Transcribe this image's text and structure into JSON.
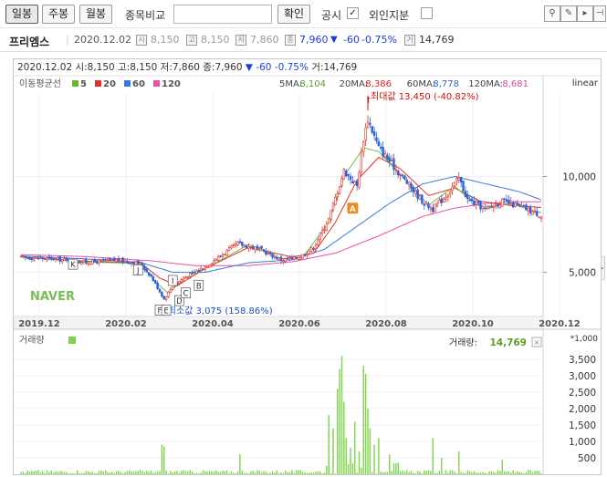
{
  "toolbar": {
    "tabs": [
      "일봉",
      "주봉",
      "월봉"
    ],
    "compare_label": "종목비교",
    "compare_value": "",
    "confirm_label": "확인",
    "disclosure_label": "공시",
    "disclosure_checked": "✓",
    "foreign_label": "외인지분",
    "foreign_checked": "",
    "right_icons": [
      "tool-icon",
      "pencil-icon",
      "cursor-icon",
      "pin-icon"
    ]
  },
  "infobar": {
    "name": "프리엠스",
    "date": "2020.12.02",
    "open_badge": "시",
    "open": "8,150",
    "high_badge": "고",
    "high": "8,150",
    "low_badge": "저",
    "low": "7,860",
    "close_badge": "종",
    "close": "7,960",
    "change_arrow": "▼",
    "change": "-60",
    "change_pct": "-0.75%",
    "volume_badge": "거",
    "volume": "14,769"
  },
  "chart_header": {
    "line": [
      {
        "text": "2020.12.02 시:",
        "color": "#333333"
      },
      {
        "text": "8,150",
        "color": "#333333"
      },
      {
        "text": " 고:",
        "color": "#333333"
      },
      {
        "text": "8,150",
        "color": "#333333"
      },
      {
        "text": " 저:",
        "color": "#333333"
      },
      {
        "text": "7,860",
        "color": "#333333"
      },
      {
        "text": " 종:",
        "color": "#333333"
      },
      {
        "text": "7,960",
        "color": "#333333"
      },
      {
        "text": " ▼",
        "color": "#1c3fd8"
      },
      {
        "text": "    -60",
        "color": "#1c3fd8"
      },
      {
        "text": "   -0.75%",
        "color": "#1c3fd8"
      },
      {
        "text": " 거:",
        "color": "#333333"
      },
      {
        "text": "14,769",
        "color": "#333333"
      }
    ],
    "scale_mode": "linear"
  },
  "ma_legend": {
    "title": "이동평균선",
    "items": [
      {
        "period": "5",
        "color": "#5fb833"
      },
      {
        "period": "20",
        "color": "#e0322a"
      },
      {
        "period": "60",
        "color": "#3a7bd5"
      },
      {
        "period": "120",
        "color": "#e94fa9"
      }
    ]
  },
  "ma_values": [
    {
      "label": "5MA:",
      "value": "8,104",
      "color": "#5a9c2a"
    },
    {
      "label": "20MA:",
      "value": "8,386",
      "color": "#d4281f"
    },
    {
      "label": "60MA:",
      "value": "8,778",
      "color": "#2f6ec6"
    },
    {
      "label": "120MA:",
      "value": "8,681",
      "color": "#d948a0"
    }
  ],
  "annotations": {
    "max_label": "최대값 13,450 (-40.82%)",
    "min_label": "최소값 3,075 (158.86%)",
    "letters": [
      "K",
      "J",
      "I",
      "F",
      "E",
      "D",
      "C",
      "B",
      "A"
    ]
  },
  "watermark": "NAVER",
  "volume_panel": {
    "title": "거래량",
    "legend_color": "#7dd34c",
    "value_label": "거래량:",
    "value": "14,769",
    "unit": "*1,000"
  },
  "chart_data": {
    "type": "candlestick",
    "x_ticks": [
      "2019.12",
      "2020.02",
      "2020.04",
      "2020.06",
      "2020.08",
      "2020.10",
      "2020.12"
    ],
    "price_ticks": [
      "10,000",
      "5,000"
    ],
    "volume_ticks": [
      "3,500",
      "3,000",
      "2,500",
      "2,000",
      "1,500",
      "1,000",
      "500"
    ],
    "price_range": [
      2600,
      14400
    ],
    "volume_range": [
      0,
      3800
    ],
    "close_anchors": [
      [
        0,
        5780
      ],
      [
        15,
        5700
      ],
      [
        30,
        5520
      ],
      [
        45,
        5650
      ],
      [
        55,
        5450
      ],
      [
        60,
        4800
      ],
      [
        66,
        3600
      ],
      [
        70,
        4300
      ],
      [
        75,
        4700
      ],
      [
        85,
        5300
      ],
      [
        100,
        6500
      ],
      [
        110,
        6200
      ],
      [
        120,
        5650
      ],
      [
        128,
        5750
      ],
      [
        135,
        6300
      ],
      [
        142,
        7800
      ],
      [
        149,
        10300
      ],
      [
        155,
        9500
      ],
      [
        158,
        12000
      ],
      [
        160,
        13000
      ],
      [
        165,
        11500
      ],
      [
        170,
        10800
      ],
      [
        180,
        9400
      ],
      [
        186,
        8600
      ],
      [
        190,
        8300
      ],
      [
        196,
        9000
      ],
      [
        202,
        9900
      ],
      [
        206,
        8800
      ],
      [
        214,
        8300
      ],
      [
        222,
        8700
      ],
      [
        232,
        8350
      ],
      [
        240,
        7960
      ]
    ],
    "ma5": [
      [
        0,
        5790
      ],
      [
        30,
        5540
      ],
      [
        55,
        5460
      ],
      [
        62,
        4500
      ],
      [
        68,
        3900
      ],
      [
        75,
        4650
      ],
      [
        90,
        5500
      ],
      [
        105,
        6450
      ],
      [
        120,
        5700
      ],
      [
        130,
        5800
      ],
      [
        142,
        7600
      ],
      [
        149,
        10000
      ],
      [
        158,
        11500
      ],
      [
        165,
        11300
      ],
      [
        175,
        10100
      ],
      [
        188,
        8500
      ],
      [
        200,
        9500
      ],
      [
        206,
        8900
      ],
      [
        214,
        8300
      ],
      [
        225,
        8600
      ],
      [
        240,
        8104
      ]
    ],
    "ma20": [
      [
        0,
        5800
      ],
      [
        30,
        5580
      ],
      [
        55,
        5500
      ],
      [
        64,
        4700
      ],
      [
        72,
        4300
      ],
      [
        85,
        5200
      ],
      [
        105,
        6300
      ],
      [
        125,
        5800
      ],
      [
        135,
        6000
      ],
      [
        145,
        7600
      ],
      [
        155,
        9800
      ],
      [
        165,
        11000
      ],
      [
        175,
        10400
      ],
      [
        188,
        9000
      ],
      [
        200,
        9400
      ],
      [
        212,
        8700
      ],
      [
        225,
        8500
      ],
      [
        240,
        8386
      ]
    ],
    "ma60": [
      [
        0,
        5850
      ],
      [
        30,
        5700
      ],
      [
        55,
        5520
      ],
      [
        70,
        5000
      ],
      [
        85,
        5000
      ],
      [
        105,
        5500
      ],
      [
        125,
        5650
      ],
      [
        140,
        6200
      ],
      [
        155,
        7400
      ],
      [
        170,
        8600
      ],
      [
        185,
        9600
      ],
      [
        200,
        10000
      ],
      [
        215,
        9600
      ],
      [
        230,
        9200
      ],
      [
        240,
        8778
      ]
    ],
    "ma120": [
      [
        0,
        5920
      ],
      [
        30,
        5820
      ],
      [
        60,
        5600
      ],
      [
        80,
        5350
      ],
      [
        105,
        5350
      ],
      [
        125,
        5550
      ],
      [
        145,
        6000
      ],
      [
        165,
        6900
      ],
      [
        185,
        7900
      ],
      [
        200,
        8350
      ],
      [
        215,
        8600
      ],
      [
        230,
        8680
      ],
      [
        240,
        8681
      ]
    ],
    "volume_spikes": [
      [
        65,
        900
      ],
      [
        66,
        850
      ],
      [
        101,
        600
      ],
      [
        142,
        1800
      ],
      [
        144,
        1400
      ],
      [
        146,
        2600
      ],
      [
        147,
        3200
      ],
      [
        148,
        3600
      ],
      [
        149,
        2200
      ],
      [
        150,
        1100
      ],
      [
        152,
        800
      ],
      [
        154,
        1600
      ],
      [
        156,
        700
      ],
      [
        158,
        3300
      ],
      [
        159,
        3050
      ],
      [
        160,
        2000
      ],
      [
        161,
        1400
      ],
      [
        163,
        900
      ],
      [
        165,
        1100
      ],
      [
        170,
        600
      ],
      [
        190,
        1100
      ],
      [
        194,
        500
      ],
      [
        202,
        700
      ],
      [
        222,
        450
      ]
    ]
  }
}
